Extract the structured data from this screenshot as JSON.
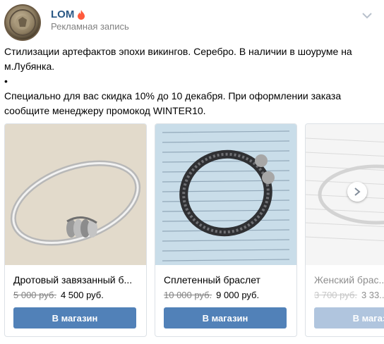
{
  "post": {
    "author": "LOM",
    "subtitle": "Рекламная запись",
    "text_line1": "Стилизации артефактов эпохи викингов. Серебро. В наличии в шоуруме на м.Лубянка.",
    "bullet": "•",
    "text_line2": "Специально для вас скидка 10% до 10 декабря. При оформлении заказа сообщите менеджеру промокод WINTER10."
  },
  "products": [
    {
      "title": "Дротовый завязанный б...",
      "old_price": "5 000 руб.",
      "new_price": "4 500 руб.",
      "button": "В магазин"
    },
    {
      "title": "Сплетенный браслет",
      "old_price": "10 000 руб.",
      "new_price": "9 000 руб.",
      "button": "В магазин"
    },
    {
      "title": "Женский брас...",
      "old_price": "3 700 руб.",
      "new_price": "3 33...",
      "button": "В магазин"
    }
  ],
  "icons": {
    "flame": "flame-icon",
    "menu": "chevron-down-icon",
    "next": "chevron-right-icon"
  },
  "colors": {
    "link": "#2a5885",
    "button": "#5181b8",
    "muted": "#828282"
  }
}
